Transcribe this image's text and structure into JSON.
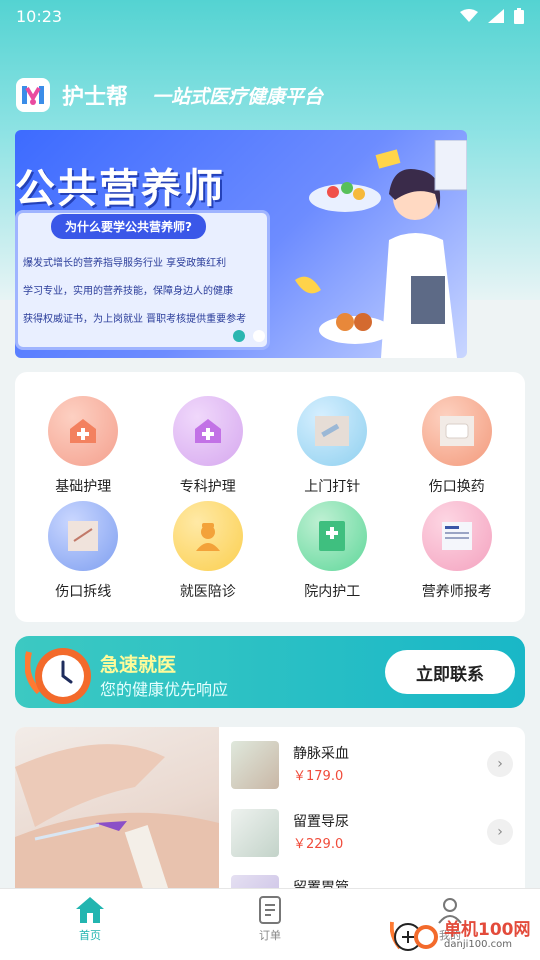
{
  "status": {
    "time": "10:23"
  },
  "brand": {
    "name": "护士帮",
    "slogan": "一站式医疗健康平台"
  },
  "banner": {
    "title": "公共营养师",
    "question": "为什么要学公共营养师?",
    "lines": [
      "爆发式增长的营养指导服务行业 享受政策红利",
      "学习专业，实用的营养技能，保障身边人的健康",
      "获得权威证书，为上岗就业 晋职考核提供重要参考"
    ]
  },
  "services": [
    {
      "label": "基础护理",
      "icon": "house-medical-icon",
      "color": "#f4a08e"
    },
    {
      "label": "专科护理",
      "icon": "house-medical-icon",
      "color": "#d6a8ef"
    },
    {
      "label": "上门打针",
      "icon": "injection-photo",
      "color": "#8fd0ef"
    },
    {
      "label": "伤口换药",
      "icon": "bandage-photo",
      "color": "#f39a7c"
    },
    {
      "label": "伤口拆线",
      "icon": "stitches-photo",
      "color": "#7f9ff0"
    },
    {
      "label": "就医陪诊",
      "icon": "nurse-icon",
      "color": "#fbcf4f"
    },
    {
      "label": "院内护工",
      "icon": "hospital-form-icon",
      "color": "#5fd79a"
    },
    {
      "label": "营养师报考",
      "icon": "certificate-photo",
      "color": "#f4a2bf"
    }
  ],
  "urgent": {
    "title": "急速就医",
    "subtitle": "您的健康优先响应",
    "button": "立即联系"
  },
  "products": [
    {
      "name": "静脉采血",
      "price": "￥179.0"
    },
    {
      "name": "留置导尿",
      "price": "￥229.0"
    },
    {
      "name": "留置胃管",
      "price": ""
    }
  ],
  "tabs": [
    {
      "label": "首页",
      "icon": "home-icon",
      "active": true
    },
    {
      "label": "订单",
      "icon": "order-icon",
      "active": false
    },
    {
      "label": "我的",
      "icon": "user-icon",
      "active": false
    }
  ],
  "watermark": {
    "name": "单机100网",
    "url": "danji100.com"
  },
  "colors": {
    "accent": "#22b5b0",
    "price": "#f04b3a"
  }
}
